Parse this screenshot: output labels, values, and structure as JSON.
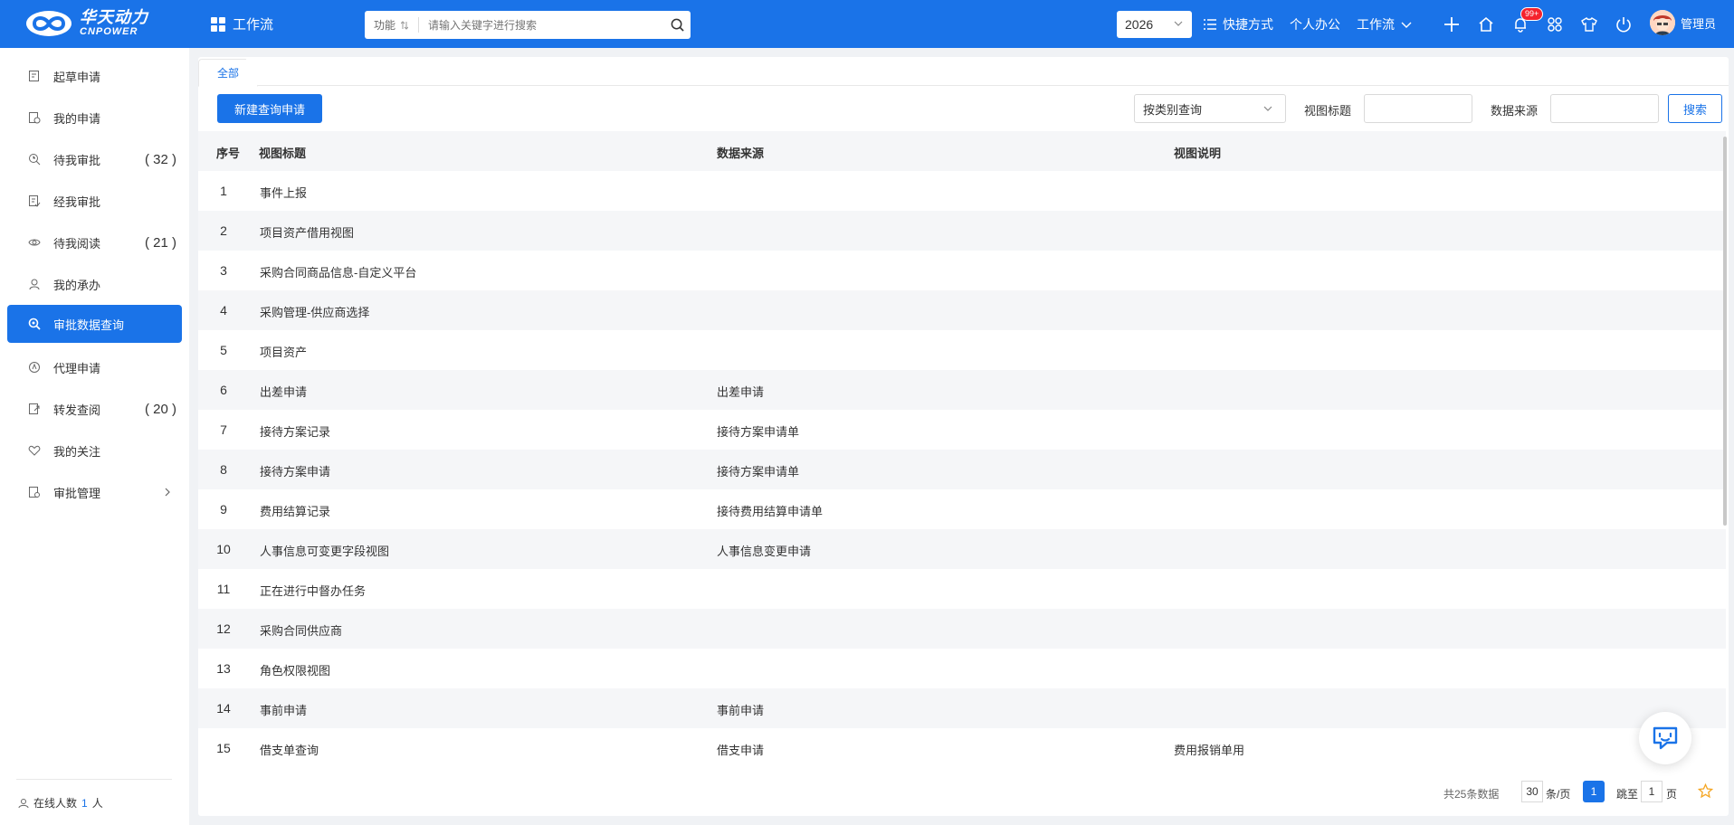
{
  "header": {
    "logo_cn": "华天动力",
    "logo_en": "CNPOWER",
    "module": "工作流",
    "search_category": "功能",
    "search_placeholder": "请输入关键字进行搜索",
    "year": "2026",
    "links": [
      {
        "label": "快捷方式",
        "icon": "list-icon"
      },
      {
        "label": "个人办公"
      },
      {
        "label": "工作流",
        "icon": "chevron-down-icon"
      }
    ],
    "notification_badge": "99+",
    "user_name": "管理员"
  },
  "sidebar": {
    "items": [
      {
        "label": "起草申请",
        "icon": "edit-doc-icon",
        "count": ""
      },
      {
        "label": "我的申请",
        "icon": "my-doc-icon",
        "count": ""
      },
      {
        "label": "待我审批",
        "icon": "pending-approve-icon",
        "count": "( 32 )"
      },
      {
        "label": "经我审批",
        "icon": "approved-icon",
        "count": ""
      },
      {
        "label": "待我阅读",
        "icon": "eye-icon",
        "count": "( 21 )"
      },
      {
        "label": "我的承办",
        "icon": "user-icon",
        "count": ""
      },
      {
        "label": "审批数据查询",
        "icon": "search-data-icon",
        "count": "",
        "active": true
      },
      {
        "label": "代理申请",
        "icon": "proxy-icon",
        "count": ""
      },
      {
        "label": "转发查阅",
        "icon": "forward-icon",
        "count": "( 20 )"
      },
      {
        "label": "我的关注",
        "icon": "heart-icon",
        "count": ""
      },
      {
        "label": "审批管理",
        "icon": "manage-icon",
        "count": "",
        "has_children": true
      }
    ],
    "online_label": "在线人数",
    "online_count": "1",
    "online_unit": "人"
  },
  "main": {
    "tab": "全部",
    "new_button": "新建查询申请",
    "filter_select": "按类别查询",
    "filter_title_label": "视图标题",
    "filter_source_label": "数据来源",
    "search_button": "搜索",
    "columns": [
      "序号",
      "视图标题",
      "数据来源",
      "视图说明"
    ],
    "rows": [
      {
        "no": "1",
        "title": "事件上报",
        "source": "",
        "desc": ""
      },
      {
        "no": "2",
        "title": "项目资产借用视图",
        "source": "",
        "desc": ""
      },
      {
        "no": "3",
        "title": "采购合同商品信息-自定义平台",
        "source": "",
        "desc": ""
      },
      {
        "no": "4",
        "title": "采购管理-供应商选择",
        "source": "",
        "desc": ""
      },
      {
        "no": "5",
        "title": "项目资产",
        "source": "",
        "desc": ""
      },
      {
        "no": "6",
        "title": "出差申请",
        "source": "出差申请",
        "desc": ""
      },
      {
        "no": "7",
        "title": "接待方案记录",
        "source": "接待方案申请单",
        "desc": ""
      },
      {
        "no": "8",
        "title": "接待方案申请",
        "source": "接待方案申请单",
        "desc": ""
      },
      {
        "no": "9",
        "title": "费用结算记录",
        "source": "接待费用结算申请单",
        "desc": ""
      },
      {
        "no": "10",
        "title": "人事信息可变更字段视图",
        "source": "人事信息变更申请",
        "desc": ""
      },
      {
        "no": "11",
        "title": "正在进行中督办任务",
        "source": "",
        "desc": ""
      },
      {
        "no": "12",
        "title": "采购合同供应商",
        "source": "",
        "desc": ""
      },
      {
        "no": "13",
        "title": "角色权限视图",
        "source": "",
        "desc": ""
      },
      {
        "no": "14",
        "title": "事前申请",
        "source": "事前申请",
        "desc": ""
      },
      {
        "no": "15",
        "title": "借支单查询",
        "source": "借支申请",
        "desc": "费用报销单用"
      }
    ],
    "pager": {
      "total": "共25条数据",
      "page_size": "30",
      "page_size_unit": "条/页",
      "current_page": "1",
      "jump_label": "跳至",
      "jump_value": "1",
      "page_unit": "页"
    }
  },
  "colors": {
    "primary": "#1a73e8",
    "row_alt": "#f5f6f8",
    "badge": "#f5222d"
  }
}
